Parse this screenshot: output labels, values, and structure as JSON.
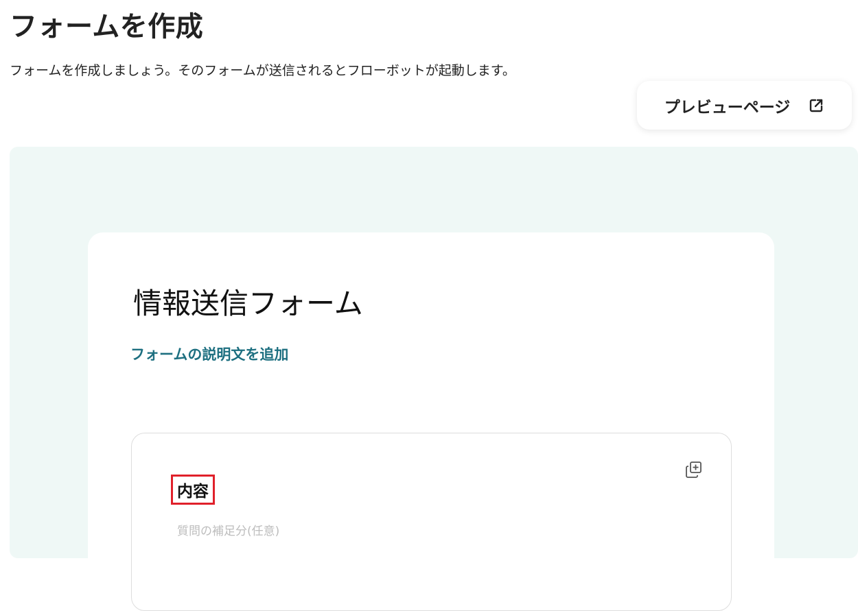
{
  "header": {
    "title": "フォームを作成",
    "description": "フォームを作成しましょう。そのフォームが送信されるとフローボットが起動します。"
  },
  "toolbar": {
    "preview_label": "プレビューページ",
    "preview_icon": "external-link-icon"
  },
  "form": {
    "title": "情報送信フォーム",
    "add_description_label": "フォームの説明文を追加",
    "questions": [
      {
        "label": "内容",
        "hint_placeholder": "質問の補足分(任意)",
        "duplicate_icon": "duplicate-icon"
      }
    ]
  },
  "colors": {
    "canvas_bg": "#eff8f6",
    "link": "#1d6f80",
    "highlight": "#e0202a"
  }
}
